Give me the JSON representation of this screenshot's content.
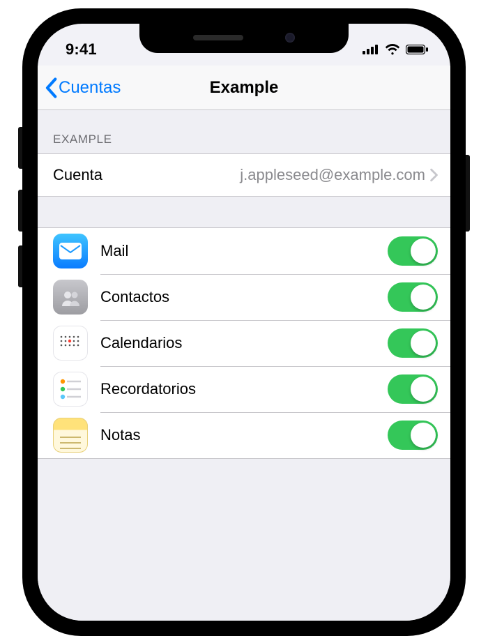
{
  "statusbar": {
    "time": "9:41"
  },
  "nav": {
    "back_label": "Cuentas",
    "title": "Example"
  },
  "section": {
    "header": "Example",
    "account_label": "Cuenta",
    "account_value": "j.appleseed@example.com"
  },
  "services": [
    {
      "id": "mail",
      "label": "Mail",
      "enabled": true
    },
    {
      "id": "contacts",
      "label": "Contactos",
      "enabled": true
    },
    {
      "id": "calendar",
      "label": "Calendarios",
      "enabled": true
    },
    {
      "id": "reminders",
      "label": "Recordatorios",
      "enabled": true
    },
    {
      "id": "notes",
      "label": "Notas",
      "enabled": true
    }
  ],
  "colors": {
    "tint": "#007aff",
    "toggle_on": "#34c759",
    "group_bg": "#efeff4"
  }
}
